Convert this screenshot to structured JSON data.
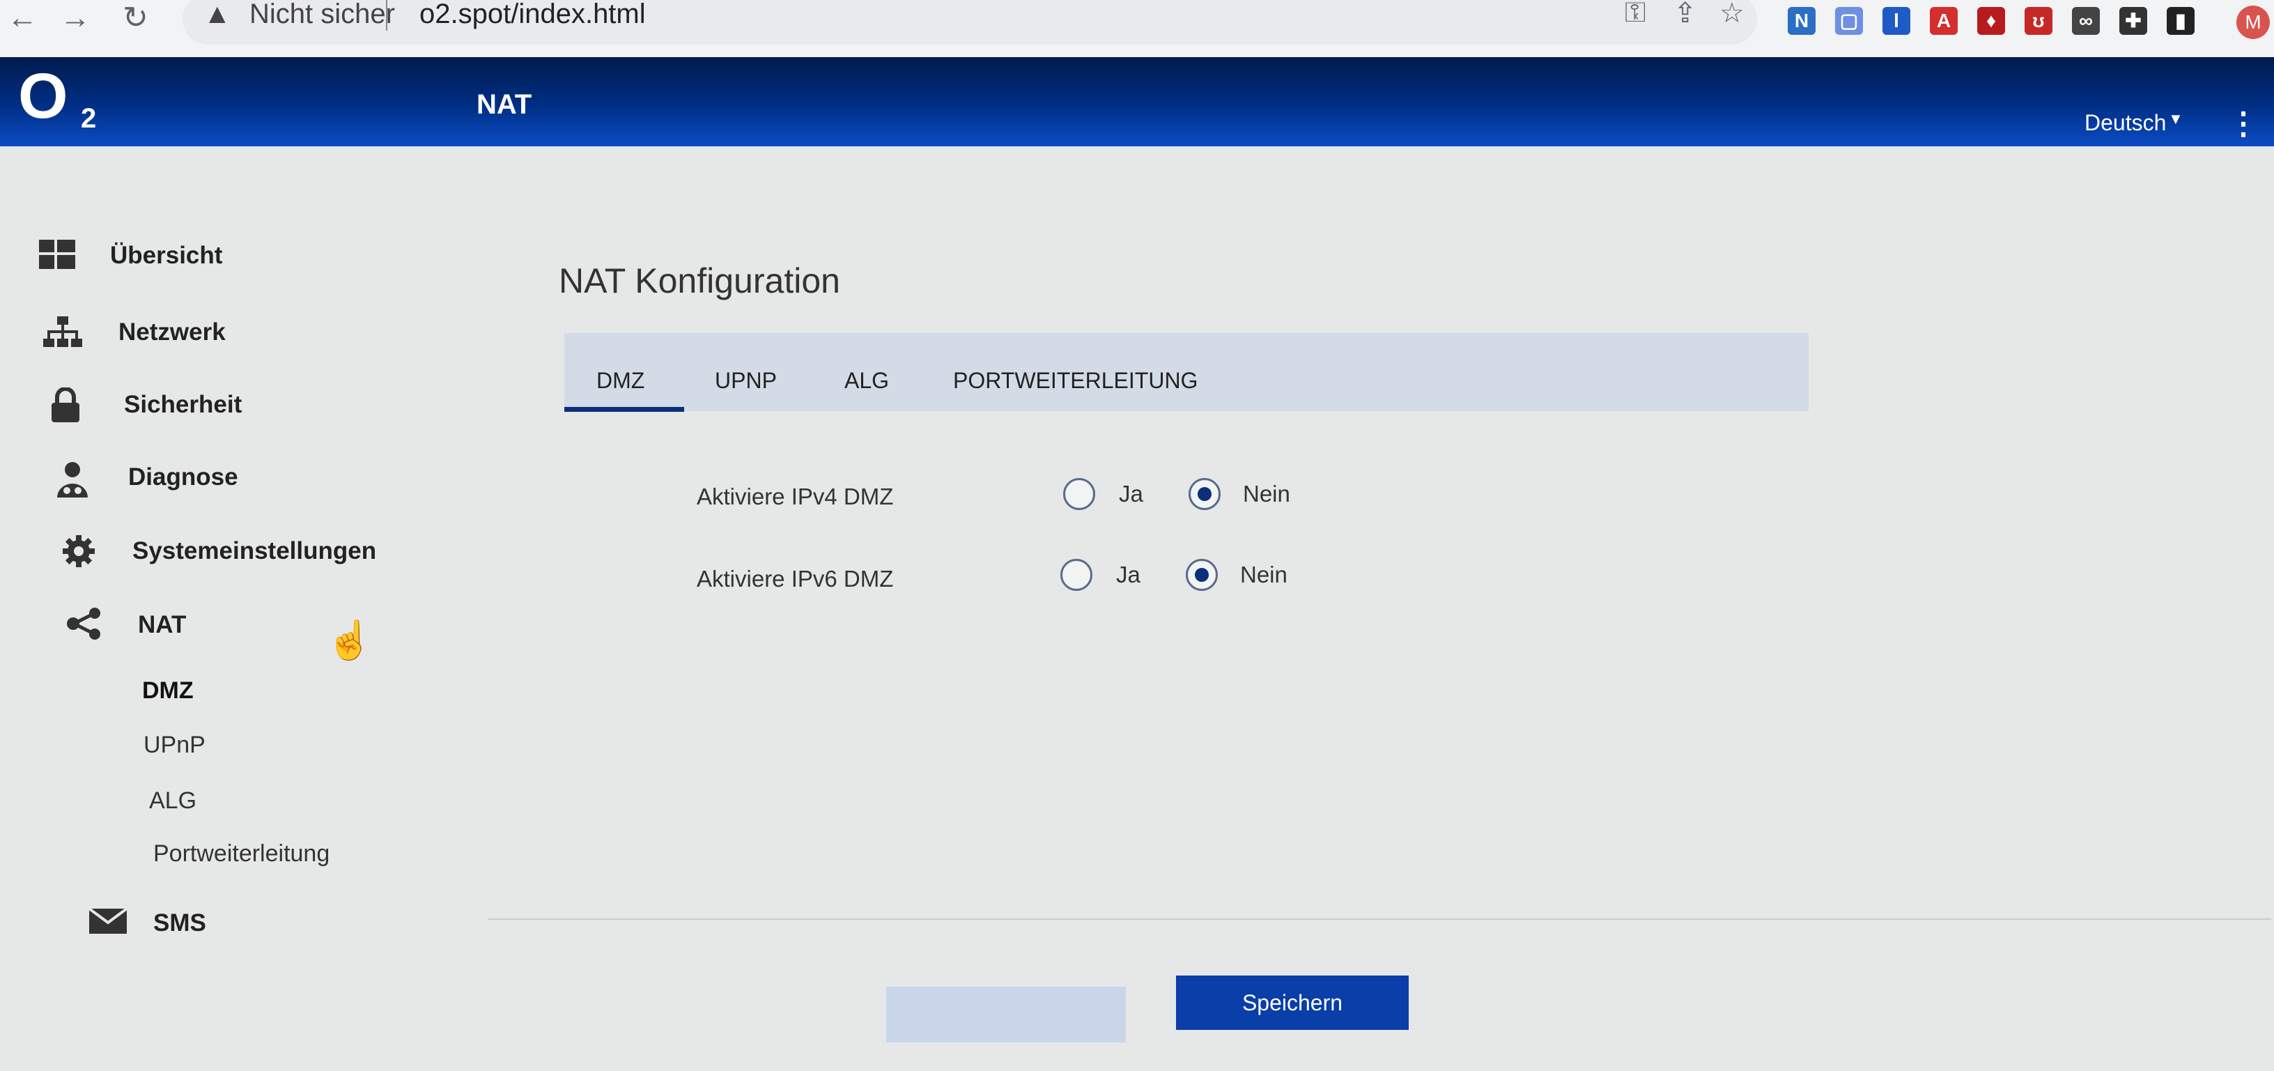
{
  "browser": {
    "security_label": "Nicht sicher",
    "url": "o2.spot/index.html",
    "profile_initial": "M",
    "extensions": [
      {
        "name": "ext-1",
        "glyph": "N",
        "color": "#2a6fc4"
      },
      {
        "name": "ext-2",
        "glyph": "▢",
        "color": "#6f8fe0"
      },
      {
        "name": "ext-3",
        "glyph": "l",
        "color": "#1e5bc6"
      },
      {
        "name": "ext-4",
        "glyph": "A",
        "color": "#d32f2f"
      },
      {
        "name": "ext-5",
        "glyph": "♦",
        "color": "#b71c1c"
      },
      {
        "name": "ext-6",
        "glyph": "ʊ",
        "color": "#c62828"
      },
      {
        "name": "ext-7",
        "glyph": "∞",
        "color": "#444444"
      },
      {
        "name": "ext-8",
        "glyph": "✚",
        "color": "#333333"
      },
      {
        "name": "ext-9",
        "glyph": "▮",
        "color": "#222222"
      }
    ]
  },
  "header": {
    "logo_o": "O",
    "logo_2": "2",
    "title": "NAT",
    "language": "Deutsch"
  },
  "sidebar": {
    "items": [
      {
        "label": "Übersicht",
        "icon": "dashboard-icon"
      },
      {
        "label": "Netzwerk",
        "icon": "network-icon"
      },
      {
        "label": "Sicherheit",
        "icon": "lock-icon"
      },
      {
        "label": "Diagnose",
        "icon": "doctor-icon"
      },
      {
        "label": "Systemeinstellungen",
        "icon": "gear-icon"
      },
      {
        "label": "NAT",
        "icon": "share-icon"
      },
      {
        "label": "SMS",
        "icon": "mail-icon"
      }
    ],
    "nat_subitems": [
      "DMZ",
      "UPnP",
      "ALG",
      "Portweiterleitung"
    ]
  },
  "main": {
    "title": "NAT Konfiguration",
    "tabs": [
      "DMZ",
      "UPNP",
      "ALG",
      "PORTWEITERLEITUNG"
    ],
    "active_tab": "DMZ",
    "fields": [
      {
        "label": "Aktiviere IPv4 DMZ",
        "yes": "Ja",
        "no": "Nein",
        "value": "Nein"
      },
      {
        "label": "Aktiviere IPv6 DMZ",
        "yes": "Ja",
        "no": "Nein",
        "value": "Nein"
      }
    ],
    "save_label": "Speichern"
  },
  "colors": {
    "header_dark": "#001b4d",
    "header_light": "#0b4cc4",
    "accent": "#0b2f7a",
    "button": "#0a3ea8"
  }
}
